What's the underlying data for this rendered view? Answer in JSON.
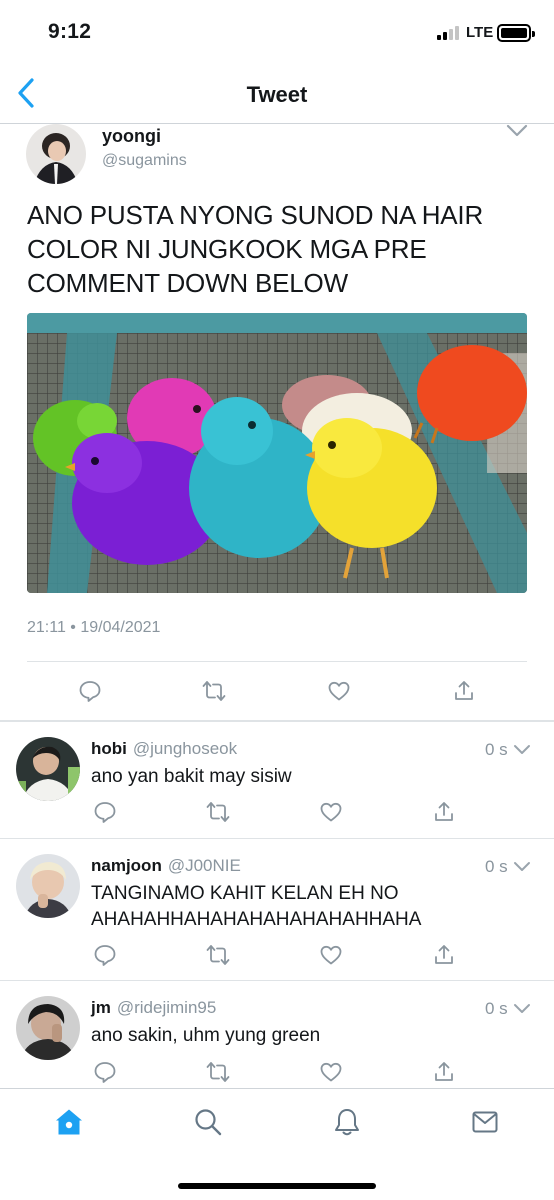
{
  "status": {
    "time": "9:12",
    "network": "LTE"
  },
  "nav": {
    "title": "Tweet"
  },
  "tweet": {
    "name": "yoongi",
    "handle": "@sugamins",
    "text": "ANO PUSTA NYONG SUNOD NA HAIR COLOR NI JUNGKOOK MGA PRE COMMENT DOWN BELOW",
    "timestamp": "21:11 • 19/04/2021"
  },
  "replies": [
    {
      "name": "hobi",
      "handle": "@junghoseok",
      "time": "0 s",
      "text": "ano yan bakit may sisiw"
    },
    {
      "name": "namjoon",
      "handle": "@J00NIE",
      "time": "0 s",
      "text": "TANGINAMO KAHIT KELAN EH NO AHAHAHHAHAHAHAHAHAHAHHAHA"
    },
    {
      "name": "jm",
      "handle": "@ridejimin95",
      "time": "0 s",
      "text": "ano sakin, uhm yung green"
    }
  ],
  "icons": {
    "reply": "reply-icon",
    "retweet": "retweet-icon",
    "like": "like-icon",
    "share": "share-icon",
    "home": "home-icon",
    "search": "search-icon",
    "notifications": "bell-icon",
    "messages": "mail-icon"
  },
  "colors": {
    "accent": "#1da1f2",
    "muted": "#8a959e",
    "divider": "#dfe3e6"
  }
}
